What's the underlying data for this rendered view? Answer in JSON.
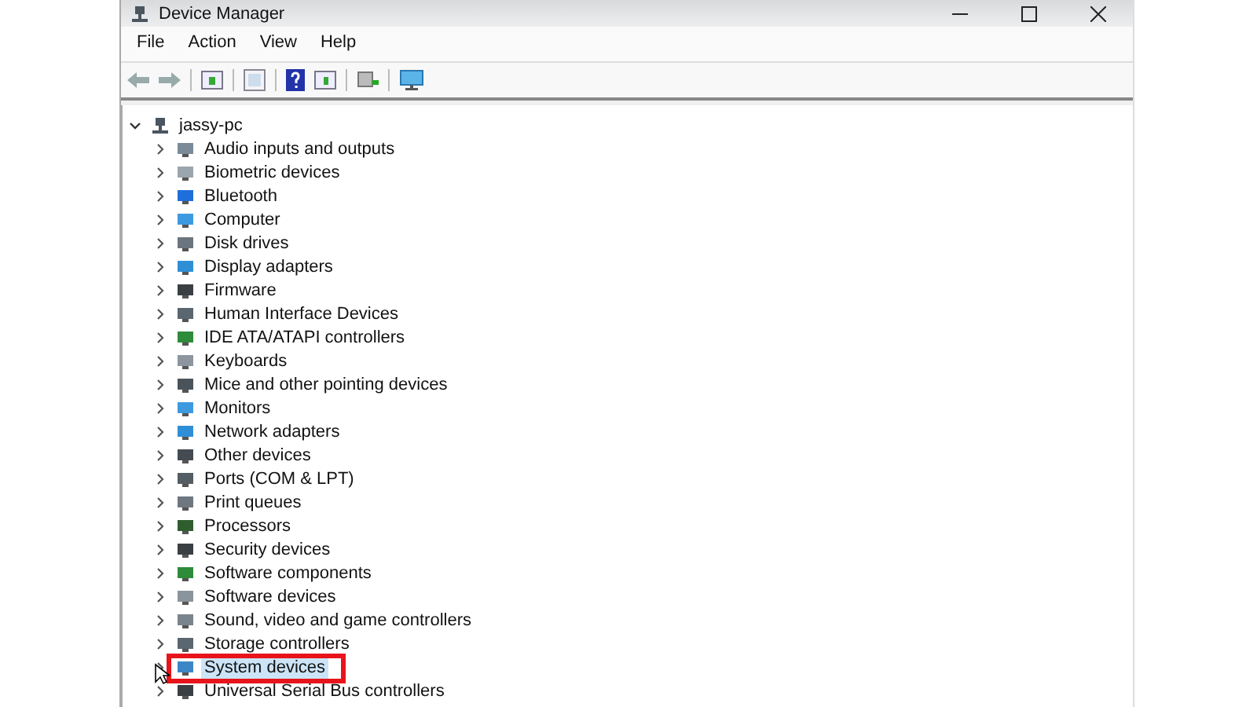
{
  "window": {
    "title": "Device Manager"
  },
  "menu": [
    "File",
    "Action",
    "View",
    "Help"
  ],
  "tree": {
    "root": {
      "label": "jassy-pc",
      "expanded": true
    },
    "items": [
      {
        "label": "Audio inputs and outputs",
        "selected": false,
        "marked": false
      },
      {
        "label": "Biometric devices",
        "selected": false,
        "marked": false
      },
      {
        "label": "Bluetooth",
        "selected": false,
        "marked": false
      },
      {
        "label": "Computer",
        "selected": false,
        "marked": false
      },
      {
        "label": "Disk drives",
        "selected": false,
        "marked": false
      },
      {
        "label": "Display adapters",
        "selected": false,
        "marked": false
      },
      {
        "label": "Firmware",
        "selected": false,
        "marked": false
      },
      {
        "label": "Human Interface Devices",
        "selected": false,
        "marked": false
      },
      {
        "label": "IDE ATA/ATAPI controllers",
        "selected": false,
        "marked": false
      },
      {
        "label": "Keyboards",
        "selected": false,
        "marked": false
      },
      {
        "label": "Mice and other pointing devices",
        "selected": false,
        "marked": false
      },
      {
        "label": "Monitors",
        "selected": false,
        "marked": false
      },
      {
        "label": "Network adapters",
        "selected": false,
        "marked": false
      },
      {
        "label": "Other devices",
        "selected": false,
        "marked": false
      },
      {
        "label": "Ports (COM & LPT)",
        "selected": false,
        "marked": false
      },
      {
        "label": "Print queues",
        "selected": false,
        "marked": false
      },
      {
        "label": "Processors",
        "selected": false,
        "marked": false
      },
      {
        "label": "Security devices",
        "selected": false,
        "marked": false
      },
      {
        "label": "Software components",
        "selected": false,
        "marked": false
      },
      {
        "label": "Software devices",
        "selected": false,
        "marked": false
      },
      {
        "label": "Sound, video and game controllers",
        "selected": false,
        "marked": false
      },
      {
        "label": "Storage controllers",
        "selected": false,
        "marked": false
      },
      {
        "label": "System devices",
        "selected": true,
        "marked": true
      },
      {
        "label": "Universal Serial Bus controllers",
        "selected": false,
        "marked": false
      }
    ]
  }
}
